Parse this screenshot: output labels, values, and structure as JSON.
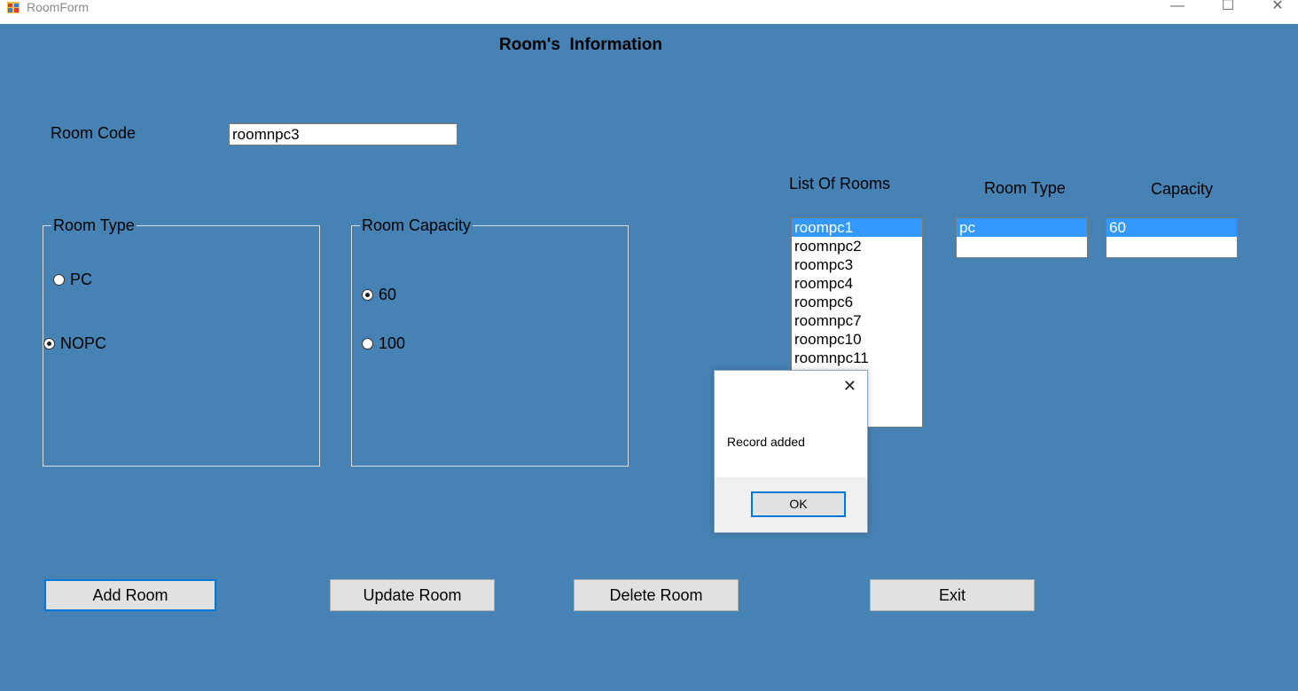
{
  "window": {
    "title": "RoomForm",
    "controls": {
      "minimize": "—",
      "maximize": "☐",
      "close": "✕"
    }
  },
  "form": {
    "heading": "Room's  Information",
    "room_code_label": "Room Code",
    "room_code_value": "roomnpc3",
    "room_type_group": {
      "title": "Room Type",
      "options": [
        {
          "label": "PC",
          "checked": false
        },
        {
          "label": "NOPC",
          "checked": true
        }
      ]
    },
    "room_capacity_group": {
      "title": "Room Capacity",
      "options": [
        {
          "label": "60",
          "checked": true
        },
        {
          "label": "100",
          "checked": false
        }
      ]
    },
    "list_of_rooms": {
      "label": "List Of Rooms",
      "items": [
        "roompc1",
        "roomnpc2",
        "roompc3",
        "roompc4",
        "roompc6",
        "roomnpc7",
        "roompc10",
        "roomnpc11"
      ],
      "selected_index": 0
    },
    "room_type_list": {
      "label": "Room Type",
      "items": [
        "pc"
      ],
      "selected_index": 0
    },
    "capacity_list": {
      "label": "Capacity",
      "items": [
        "60"
      ],
      "selected_index": 0
    },
    "buttons": {
      "add": "Add Room",
      "update": "Update Room",
      "delete": "Delete Room",
      "exit": "Exit"
    }
  },
  "message_box": {
    "text": "Record added",
    "ok_label": "OK",
    "close_glyph": "✕"
  },
  "colors": {
    "form_background": "#4682B4",
    "selection": "#3399FF",
    "focus_border": "#0078D7"
  }
}
